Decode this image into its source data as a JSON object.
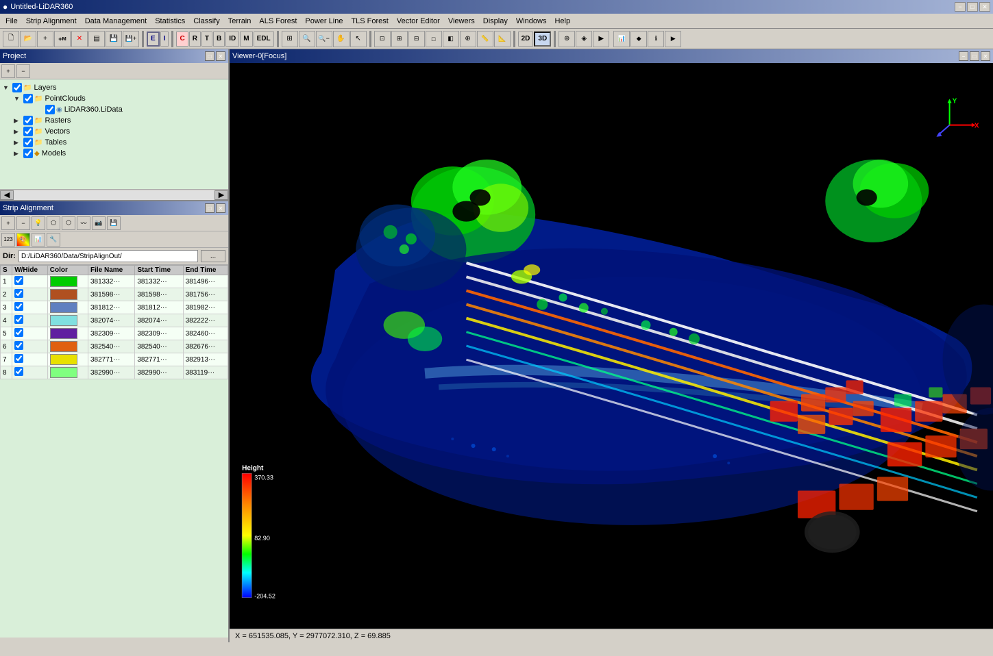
{
  "app": {
    "title": "Untitled-LiDAR360",
    "icon": "●"
  },
  "title_bar": {
    "title": "Untitled-LiDAR360",
    "minimize": "−",
    "maximize": "□",
    "close": "✕"
  },
  "menu": {
    "items": [
      {
        "id": "file",
        "label": "File"
      },
      {
        "id": "strip-alignment",
        "label": "Strip Alignment"
      },
      {
        "id": "data-management",
        "label": "Data Management"
      },
      {
        "id": "statistics",
        "label": "Statistics"
      },
      {
        "id": "classify",
        "label": "Classify"
      },
      {
        "id": "terrain",
        "label": "Terrain"
      },
      {
        "id": "als-forest",
        "label": "ALS Forest"
      },
      {
        "id": "power-line",
        "label": "Power Line"
      },
      {
        "id": "tls-forest",
        "label": "TLS Forest"
      },
      {
        "id": "vector-editor",
        "label": "Vector Editor"
      },
      {
        "id": "viewers",
        "label": "Viewers"
      },
      {
        "id": "display",
        "label": "Display"
      },
      {
        "id": "windows",
        "label": "Windows"
      },
      {
        "id": "help",
        "label": "Help"
      }
    ]
  },
  "toolbar": {
    "buttons": [
      {
        "id": "new",
        "label": "🗋",
        "title": "New"
      },
      {
        "id": "open-folder",
        "label": "📁",
        "title": "Open Folder"
      },
      {
        "id": "add",
        "label": "+",
        "title": "Add"
      },
      {
        "id": "add-m",
        "label": "M",
        "title": "Add M",
        "subscript": true
      },
      {
        "id": "delete",
        "label": "✕",
        "title": "Delete"
      },
      {
        "id": "properties",
        "label": "▤",
        "title": "Properties"
      },
      {
        "id": "save",
        "label": "💾",
        "title": "Save"
      },
      {
        "id": "save-as",
        "label": "💾+",
        "title": "Save As"
      },
      {
        "id": "edit-e",
        "label": "E",
        "title": "Edit E",
        "bold": true
      },
      {
        "id": "edit-i",
        "label": "I",
        "title": "Edit I",
        "bold": true
      },
      {
        "id": "classify-c",
        "label": "C",
        "title": "Classify C",
        "bold": true
      },
      {
        "id": "classify-r",
        "label": "R",
        "title": "R",
        "bold": true
      },
      {
        "id": "classify-t",
        "label": "T",
        "title": "T",
        "bold": true
      },
      {
        "id": "classify-b",
        "label": "B",
        "title": "B",
        "bold": true
      },
      {
        "id": "classify-id",
        "label": "ID",
        "title": "ID",
        "bold": true
      },
      {
        "id": "classify-m",
        "label": "M",
        "title": "M",
        "bold": true
      },
      {
        "id": "edl",
        "label": "EDL",
        "title": "EDL"
      },
      {
        "id": "zoom-fit",
        "label": "⊞",
        "title": "Zoom Fit"
      },
      {
        "id": "zoom-in",
        "label": "🔍+",
        "title": "Zoom In"
      },
      {
        "id": "zoom-out",
        "label": "🔍-",
        "title": "Zoom Out"
      },
      {
        "id": "pan",
        "label": "✋",
        "title": "Pan"
      },
      {
        "id": "select",
        "label": "↖",
        "title": "Select"
      },
      {
        "id": "view1",
        "label": "🖥",
        "title": "View 1"
      },
      {
        "id": "view2",
        "label": "🖥",
        "title": "View 2"
      },
      {
        "id": "view3",
        "label": "🖥",
        "title": "View 3"
      },
      {
        "id": "view4",
        "label": "□",
        "title": "View 4"
      },
      {
        "id": "view5",
        "label": "⬜",
        "title": "View 5"
      },
      {
        "id": "axis",
        "label": "⊕",
        "title": "Axis"
      },
      {
        "id": "measure",
        "label": "📏",
        "title": "Measure"
      },
      {
        "id": "measure2",
        "label": "📐",
        "title": "Measure 2"
      },
      {
        "id": "2d-btn",
        "label": "2D",
        "title": "2D View"
      },
      {
        "id": "3d-btn",
        "label": "3D",
        "title": "3D View"
      }
    ]
  },
  "project_panel": {
    "title": "Project",
    "tree": {
      "layers": {
        "label": "Layers",
        "checked": true,
        "children": {
          "pointclouds": {
            "label": "PointClouds",
            "checked": true,
            "children": {
              "lidata": {
                "label": "LiDAR360.LiData",
                "checked": true
              }
            }
          },
          "rasters": {
            "label": "Rasters",
            "checked": true
          },
          "vectors": {
            "label": "Vectors",
            "checked": true
          },
          "tables": {
            "label": "Tables",
            "checked": true
          },
          "models": {
            "label": "Models",
            "checked": true
          }
        }
      }
    }
  },
  "strip_panel": {
    "title": "Strip Alignment",
    "dir_label": "Dir:",
    "dir_value": "D:/LiDAR360/Data/StripAlignOut/",
    "dir_btn": "...",
    "table_headers": [
      "S",
      "W/Hide",
      "Color",
      "File Name",
      "Start Time",
      "End Time"
    ],
    "rows": [
      {
        "s": "1",
        "checked": true,
        "color": "#00cc00",
        "filename": "381332···",
        "start": "381332···",
        "end": "381496···"
      },
      {
        "s": "2",
        "checked": true,
        "color": "#b05020",
        "filename": "381598···",
        "start": "381598···",
        "end": "381756···"
      },
      {
        "s": "3",
        "checked": true,
        "color": "#6080c0",
        "filename": "381812···",
        "start": "381812···",
        "end": "381982···"
      },
      {
        "s": "4",
        "checked": true,
        "color": "#80e0e0",
        "filename": "382074···",
        "start": "382074···",
        "end": "382222···"
      },
      {
        "s": "5",
        "checked": true,
        "color": "#6020a0",
        "filename": "382309···",
        "start": "382309···",
        "end": "382460···"
      },
      {
        "s": "6",
        "checked": true,
        "color": "#e06010",
        "filename": "382540···",
        "start": "382540···",
        "end": "382676···"
      },
      {
        "s": "7",
        "checked": true,
        "color": "#e8e000",
        "filename": "382771···",
        "start": "382771···",
        "end": "382913···"
      },
      {
        "s": "8",
        "checked": true,
        "color": "#80ff80",
        "filename": "382990···",
        "start": "382990···",
        "end": "383119···"
      }
    ]
  },
  "viewer": {
    "title": "Viewer-0[Focus]",
    "minimize": "−",
    "restore": "□",
    "close": "✕"
  },
  "height_legend": {
    "title": "Height",
    "max": "370.33",
    "mid": "82.90",
    "min": "-204.52"
  },
  "status_bar": {
    "coords": "X = 651535.085, Y = 2977072.310, Z = 69.885"
  }
}
